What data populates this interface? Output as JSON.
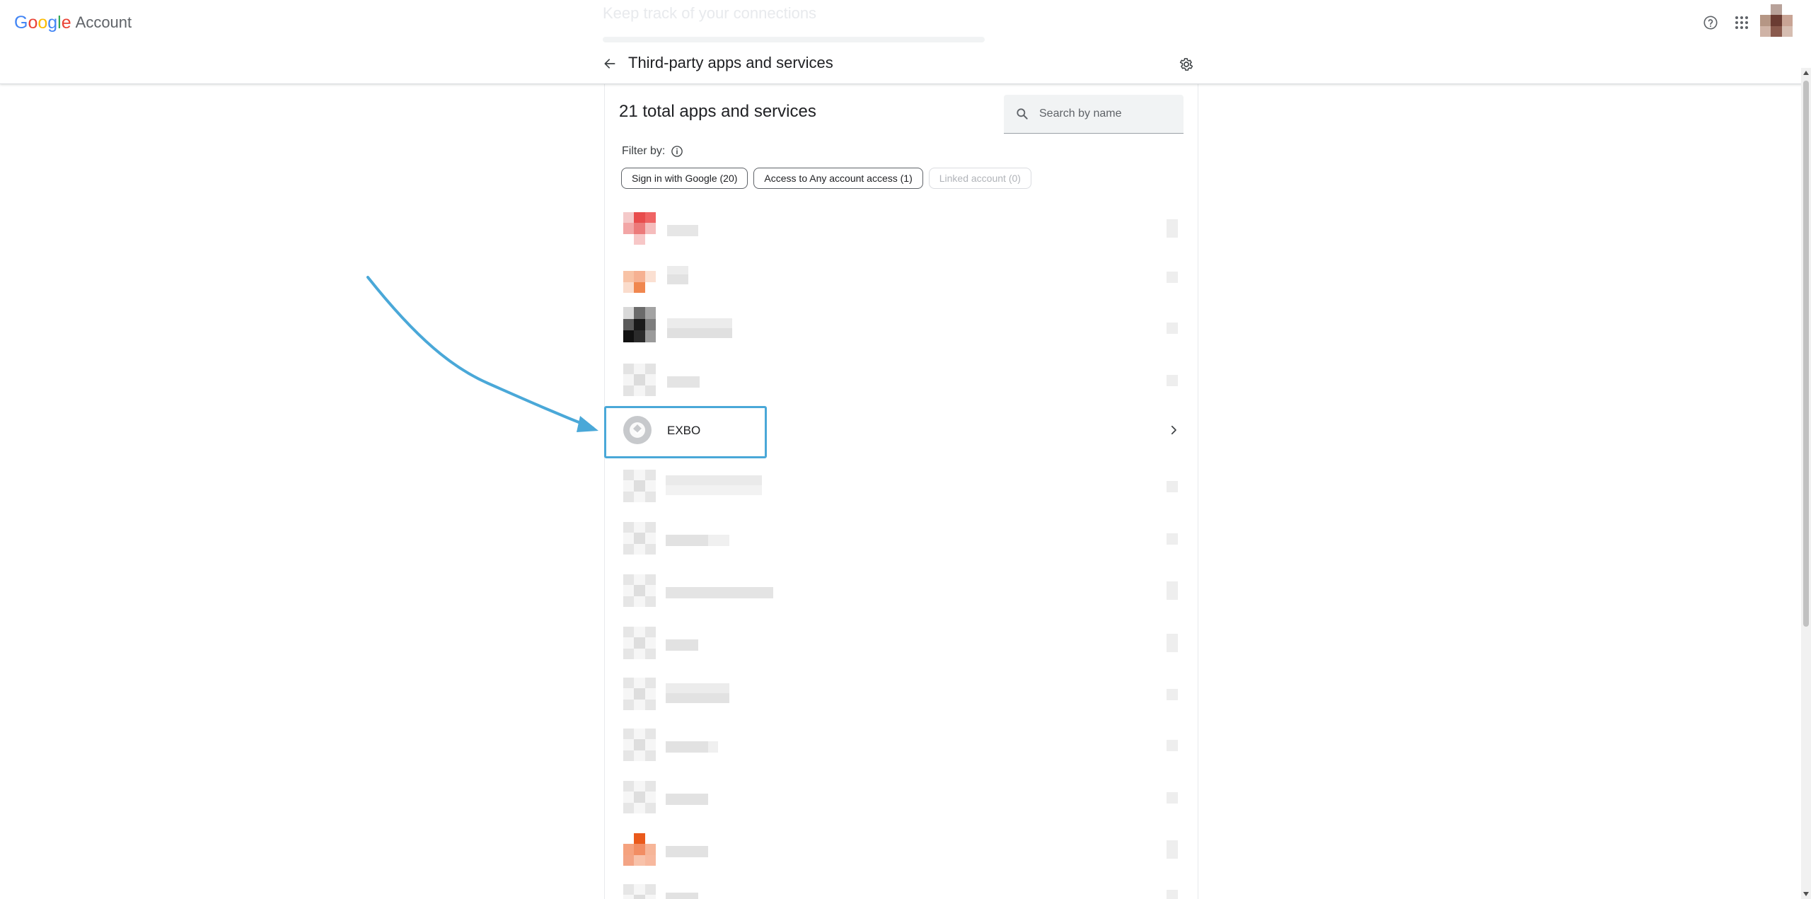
{
  "brand": {
    "logo_letters": [
      "G",
      "o",
      "o",
      "g",
      "l",
      "e"
    ],
    "logo_colors": [
      "#4285F4",
      "#EA4335",
      "#FBBC05",
      "#4285F4",
      "#34A853",
      "#EA4335"
    ],
    "product": "Account"
  },
  "header": {
    "ghost_title": "Keep track of your connections",
    "page_title": "Third-party apps and services",
    "icons": {
      "help": "help-circle-icon",
      "apps": "apps-grid-icon",
      "back": "arrow-back-icon",
      "settings": "gear-icon"
    }
  },
  "content": {
    "total_label": "21 total apps and services",
    "search": {
      "placeholder": "Search by name",
      "value": ""
    },
    "filter_label": "Filter by:",
    "filter_chips": [
      {
        "label": "Sign in with Google (20)",
        "enabled": true
      },
      {
        "label": "Access to Any account access (1)",
        "enabled": true
      },
      {
        "label": "Linked account (0)",
        "enabled": false
      }
    ]
  },
  "apps": {
    "highlighted": {
      "name": "EXBO",
      "icon": "circular-logo-icon"
    },
    "redacted_count": 13
  },
  "annotation": {
    "color": "#4aa8d8"
  },
  "theme": {
    "text": "#202124",
    "muted": "#5f6368",
    "divider": "#dadce0",
    "accent": "#1a73e8"
  }
}
